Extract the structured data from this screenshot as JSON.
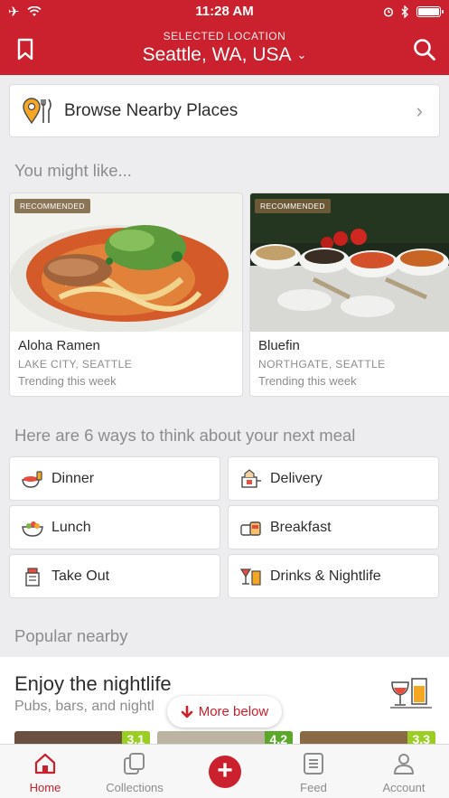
{
  "status_bar": {
    "time": "11:28 AM"
  },
  "header": {
    "location_label": "SELECTED LOCATION",
    "location": "Seattle, WA, USA"
  },
  "browse": {
    "label": "Browse Nearby Places"
  },
  "recommendations": {
    "title": "You might like...",
    "cards": [
      {
        "badge": "RECOMMENDED",
        "name": "Aloha Ramen",
        "area": "LAKE CITY, SEATTLE",
        "note": "Trending this week"
      },
      {
        "badge": "RECOMMENDED",
        "name": "Bluefin",
        "area": "NORTHGATE, SEATTLE",
        "note": "Trending this week"
      }
    ]
  },
  "meals": {
    "title": "Here are 6 ways to think about your next meal",
    "items": [
      {
        "label": "Dinner",
        "icon": "dinner-icon"
      },
      {
        "label": "Delivery",
        "icon": "delivery-icon"
      },
      {
        "label": "Lunch",
        "icon": "lunch-icon"
      },
      {
        "label": "Breakfast",
        "icon": "breakfast-icon"
      },
      {
        "label": "Take Out",
        "icon": "takeout-icon"
      },
      {
        "label": "Drinks & Nightlife",
        "icon": "drinks-icon"
      }
    ]
  },
  "popular": {
    "title": "Popular nearby",
    "collection_title": "Enjoy the nightlife",
    "collection_subtitle": "Pubs, bars, and nightl",
    "ratings": [
      "3.1",
      "4.2",
      "3.3"
    ],
    "more_label": "More below"
  },
  "tabs": [
    {
      "label": "Home",
      "icon": "home-icon"
    },
    {
      "label": "Collections",
      "icon": "collections-icon"
    },
    {
      "label": "",
      "icon": "add-icon"
    },
    {
      "label": "Feed",
      "icon": "feed-icon"
    },
    {
      "label": "Account",
      "icon": "account-icon"
    }
  ],
  "colors": {
    "brand": "#cb202d",
    "rating": "#9ace22"
  }
}
